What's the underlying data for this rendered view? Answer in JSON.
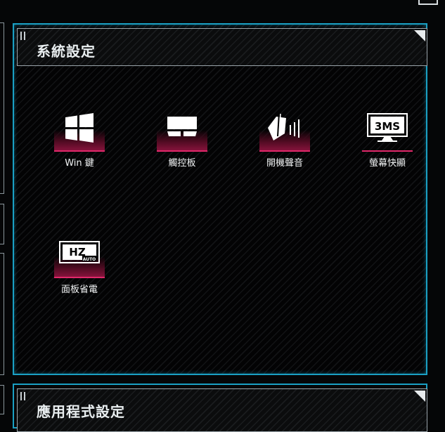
{
  "system_panel": {
    "title": "系統設定",
    "items": [
      {
        "label": "Win 鍵",
        "icon": "windows-key-icon"
      },
      {
        "label": "觸控板",
        "icon": "touchpad-icon"
      },
      {
        "label": "開機聲音",
        "icon": "boot-sound-icon"
      },
      {
        "label": "螢幕快顯",
        "icon": "panel-overdrive-icon",
        "icon_text": "3MS"
      },
      {
        "label": "面板省電",
        "icon": "panel-power-saver-icon",
        "icon_text": "HZ",
        "icon_subtext": "AUTO"
      }
    ]
  },
  "app_panel": {
    "title": "應用程式設定"
  },
  "colors": {
    "panel_border": "#1aa0c4",
    "accent": "#e0286a",
    "background": "#050607"
  }
}
